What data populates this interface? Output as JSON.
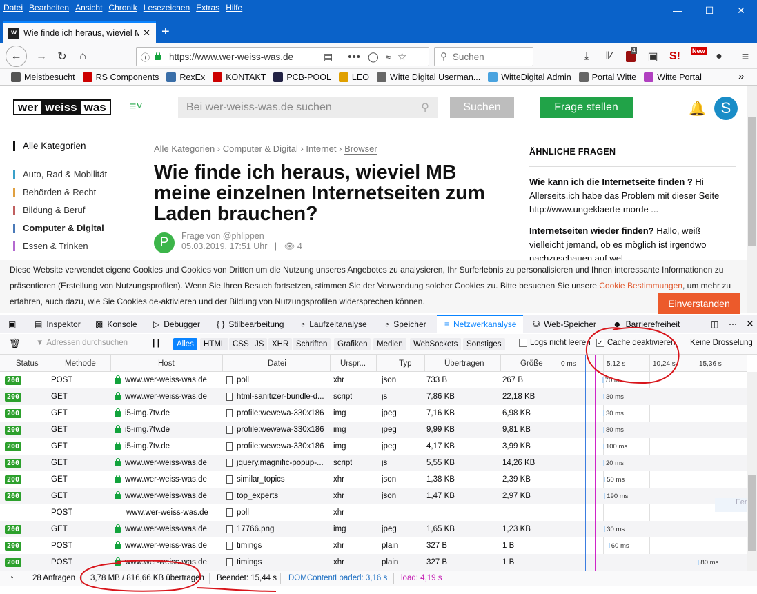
{
  "menubar": {
    "items": [
      "Datei",
      "Bearbeiten",
      "Ansicht",
      "Chronik",
      "Lesezeichen",
      "Extras",
      "Hilfe"
    ],
    "window_controls": [
      "minimize",
      "maximize",
      "close"
    ]
  },
  "tab": {
    "title": "Wie finde ich heraus, wieviel M",
    "favicon": "w"
  },
  "navbar": {
    "url": "https://www.wer-weiss-was.de",
    "search_placeholder": "Suchen",
    "ext_badges": {
      "ublock": "4",
      "new": "New",
      "s": "S!"
    }
  },
  "bookmarks": [
    {
      "label": "Meistbesucht",
      "icon": "gear-icon",
      "color": "#555"
    },
    {
      "label": "RS Components",
      "icon": "rs-icon",
      "color": "#c00"
    },
    {
      "label": "RexEx",
      "icon": "r-icon",
      "color": "#3a6ea8"
    },
    {
      "label": "KONTAKT",
      "icon": "kontakt-icon",
      "color": "#c00"
    },
    {
      "label": "PCB-POOL",
      "icon": "pcb-icon",
      "color": "#224"
    },
    {
      "label": "LEO",
      "icon": "leo-icon",
      "color": "#e0a000"
    },
    {
      "label": "Witte Digital Userman...",
      "icon": "hand-icon",
      "color": "#666"
    },
    {
      "label": "WitteDigital Admin",
      "icon": "page-icon",
      "color": "#4aa3df"
    },
    {
      "label": "Portal Witte",
      "icon": "hand-icon",
      "color": "#666"
    },
    {
      "label": "Witte Portal",
      "icon": "umbrella-icon",
      "color": "#b040c0"
    }
  ],
  "site": {
    "logo": [
      "wer",
      "weiss",
      "was"
    ],
    "search_placeholder": "Bei wer-weiss-was.de suchen",
    "search_button": "Suchen",
    "ask_button": "Frage stellen",
    "avatar_letter": "S",
    "categories_head": "Alle Kategorien",
    "categories": [
      {
        "label": "Auto, Rad & Mobilität",
        "color": "#3aa0c9"
      },
      {
        "label": "Behörden & Recht",
        "color": "#e0a040"
      },
      {
        "label": "Bildung & Beruf",
        "color": "#c06060"
      },
      {
        "label": "Computer & Digital",
        "color": "#4a7ab8",
        "active": true
      },
      {
        "label": "Essen & Trinken",
        "color": "#b46ad0"
      }
    ],
    "breadcrumb": [
      "Alle Kategorien",
      "Computer & Digital",
      "Internet",
      "Browser"
    ],
    "question_title": "Wie finde ich heraus, wieviel MB meine einzelnen Internetseiten zum Laden brauchen?",
    "author_letter": "P",
    "author": "Frage von @phlippen",
    "date": "05.03.2019, 17:51 Uhr",
    "views": "4",
    "similar_head": "ÄHNLICHE FRAGEN",
    "similar": [
      {
        "title": "Wie kann ich die Internetseite finden ?",
        "text": " Hi Allerseits,ich habe das Problem mit dieser Seite http://www.ungeklaerte-morde ..."
      },
      {
        "title": "Internetseiten wieder finden?",
        "text": " Hallo, weiß vielleicht jemand, ob es möglich ist irgendwo nachzuschauen auf wel ..."
      }
    ]
  },
  "cookie": {
    "text": "Diese Website verwendet eigene Cookies und Cookies von Dritten um die Nutzung unseres Angebotes zu analysieren, Ihr Surferlebnis zu personalisieren und Ihnen interessante Informationen zu präsentieren (Erstellung von Nutzungsprofilen). Wenn Sie Ihren Besuch fortsetzen, stimmen Sie der Verwendung solcher Cookies zu. Bitte besuchen Sie unsere ",
    "link": "Cookie Bestimmungen",
    "text2": ", um mehr zu erfahren, auch dazu, wie Sie Cookies de-aktivieren und der Bildung von Nutzungsprofilen widersprechen können.",
    "button": "Einverstanden"
  },
  "devtools": {
    "tabs": [
      "Inspektor",
      "Konsole",
      "Debugger",
      "Stilbearbeitung",
      "Laufzeitanalyse",
      "Speicher",
      "Netzwerkanalyse",
      "Web-Speicher",
      "Barrierefreiheit"
    ],
    "active_tab": "Netzwerkanalyse",
    "filter_placeholder": "Adressen durchsuchen",
    "filters": [
      "Alles",
      "HTML",
      "CSS",
      "JS",
      "XHR",
      "Schriften",
      "Grafiken",
      "Medien",
      "WebSockets",
      "Sonstiges"
    ],
    "persist_logs": "Logs nicht leeren",
    "disable_cache": "Cache deaktivieren",
    "throttle": "Keine Drosselung",
    "columns": [
      "Status",
      "Methode",
      "Host",
      "Datei",
      "Urspr...",
      "Typ",
      "Übertragen",
      "Größe"
    ],
    "timeline_ticks": [
      "0 ms",
      "5,12 s",
      "10,24 s",
      "15,36 s"
    ],
    "rows": [
      {
        "status": "200",
        "method": "POST",
        "host": "www.wer-weiss-was.de",
        "file": "poll",
        "cause": "xhr",
        "type": "json",
        "transferred": "733 B",
        "size": "267 B",
        "timing": "70 ms"
      },
      {
        "status": "200",
        "method": "GET",
        "host": "www.wer-weiss-was.de",
        "file": "html-sanitizer-bundle-d...",
        "cause": "script",
        "type": "js",
        "transferred": "7,86 KB",
        "size": "22,18 KB",
        "timing": "30 ms"
      },
      {
        "status": "200",
        "method": "GET",
        "host": "i5-img.7tv.de",
        "file": "profile:wewewa-330x186",
        "cause": "img",
        "type": "jpeg",
        "transferred": "7,16 KB",
        "size": "6,98 KB",
        "timing": "30 ms"
      },
      {
        "status": "200",
        "method": "GET",
        "host": "i5-img.7tv.de",
        "file": "profile:wewewa-330x186",
        "cause": "img",
        "type": "jpeg",
        "transferred": "9,99 KB",
        "size": "9,81 KB",
        "timing": "80 ms"
      },
      {
        "status": "200",
        "method": "GET",
        "host": "i5-img.7tv.de",
        "file": "profile:wewewa-330x186",
        "cause": "img",
        "type": "jpeg",
        "transferred": "4,17 KB",
        "size": "3,99 KB",
        "timing": "100 ms"
      },
      {
        "status": "200",
        "method": "GET",
        "host": "www.wer-weiss-was.de",
        "file": "jquery.magnific-popup-...",
        "cause": "script",
        "type": "js",
        "transferred": "5,55 KB",
        "size": "14,26 KB",
        "timing": "20 ms"
      },
      {
        "status": "200",
        "method": "GET",
        "host": "www.wer-weiss-was.de",
        "file": "similar_topics",
        "cause": "xhr",
        "type": "json",
        "transferred": "1,38 KB",
        "size": "2,39 KB",
        "timing": "50 ms"
      },
      {
        "status": "200",
        "method": "GET",
        "host": "www.wer-weiss-was.de",
        "file": "top_experts",
        "cause": "xhr",
        "type": "json",
        "transferred": "1,47 KB",
        "size": "2,97 KB",
        "timing": "190 ms"
      },
      {
        "status": "",
        "method": "POST",
        "host": "www.wer-weiss-was.de",
        "file": "poll",
        "cause": "xhr",
        "type": "",
        "transferred": "",
        "size": "",
        "timing": ""
      },
      {
        "status": "200",
        "method": "GET",
        "host": "www.wer-weiss-was.de",
        "file": "17766.png",
        "cause": "img",
        "type": "jpeg",
        "transferred": "1,65 KB",
        "size": "1,23 KB",
        "timing": "30 ms"
      },
      {
        "status": "200",
        "method": "POST",
        "host": "www.wer-weiss-was.de",
        "file": "timings",
        "cause": "xhr",
        "type": "plain",
        "transferred": "327 B",
        "size": "1 B",
        "timing": "60 ms"
      },
      {
        "status": "200",
        "method": "POST",
        "host": "www.wer-weiss-was.de",
        "file": "timings",
        "cause": "xhr",
        "type": "plain",
        "transferred": "327 B",
        "size": "1 B",
        "timing": "80 ms"
      }
    ],
    "status": {
      "requests": "28 Anfragen",
      "transferred": "3,78 MB / 816,66 KB übertragen",
      "finished": "Beendet: 15,44 s",
      "dcl": "DOMContentLoaded: 3,16 s",
      "load": "load: 4,19 s"
    },
    "ghost_text": "Fenst"
  },
  "colors": {
    "accent": "#0a62c9",
    "site_green": "#21a348",
    "cookie_orange": "#ec5a2b",
    "annotation_red": "#d8151b",
    "dcl_blue": "#3b7de0",
    "load_pink": "#d024c8"
  }
}
